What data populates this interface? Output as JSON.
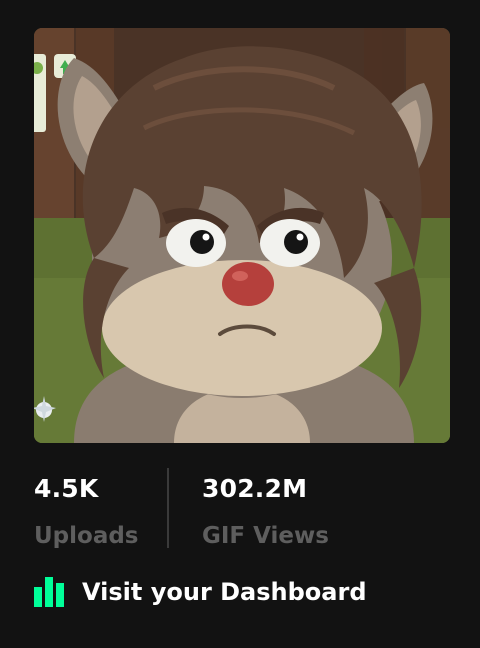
{
  "stats": {
    "uploads": {
      "value": "4.5K",
      "label": "Uploads"
    },
    "views": {
      "value": "302.2M",
      "label": "GIF Views"
    }
  },
  "dashboard_link": {
    "label": "Visit your Dashboard",
    "icon": "bar-chart-icon",
    "icon_colors": [
      "#00ff99",
      "#00ff99",
      "#00ff99"
    ]
  },
  "colors": {
    "background": "#121212",
    "label_gray": "#5e5e5e",
    "accent_green": "#00ff99"
  }
}
